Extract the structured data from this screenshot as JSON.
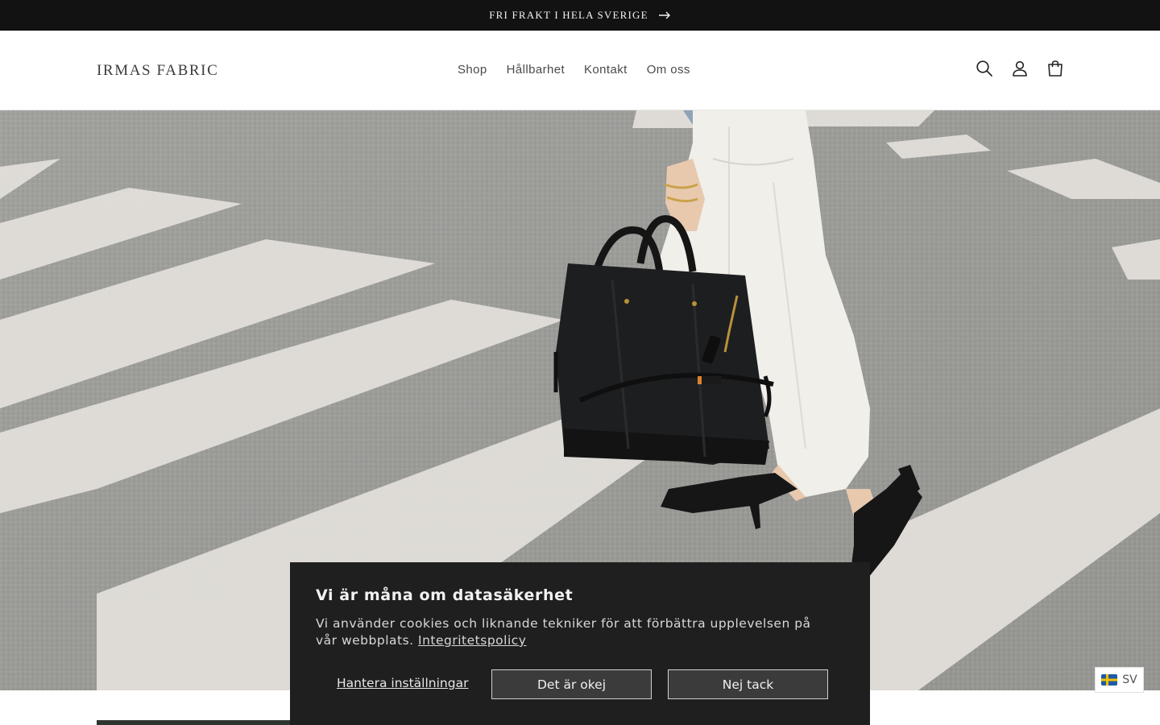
{
  "announcement": {
    "text": "FRI FRAKT I HELA SVERIGE",
    "arrow_icon": "arrow-right-icon"
  },
  "header": {
    "logo": "IRMAS FABRIC",
    "nav": [
      {
        "label": "Shop"
      },
      {
        "label": "Hållbarhet"
      },
      {
        "label": "Kontakt"
      },
      {
        "label": "Om oss"
      }
    ],
    "icons": [
      "search-icon",
      "account-icon",
      "cart-icon"
    ]
  },
  "cookie_banner": {
    "title": "Vi är måna om datasäkerhet",
    "text": "Vi använder cookies och liknande tekniker för att förbättra upplevelsen på vår webbplats.",
    "policy_link": "Integritetspolicy",
    "manage_label": "Hantera inställningar",
    "accept_label": "Det är okej",
    "decline_label": "Nej tack"
  },
  "language": {
    "code": "SV",
    "flag_icon": "sweden-flag-icon"
  },
  "colors": {
    "announcement_bg": "#121212",
    "cookie_bg": "#1f1f1f",
    "button_bg": "#3b3b3b"
  }
}
